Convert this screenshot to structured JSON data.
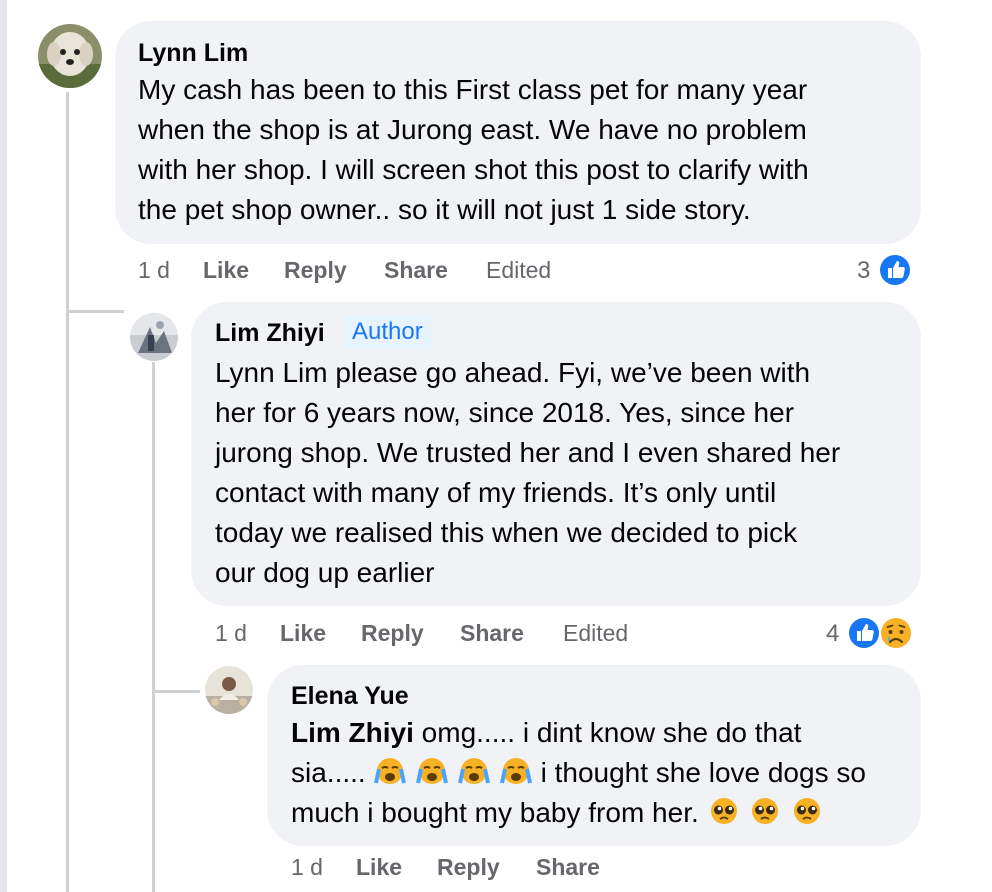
{
  "comments": [
    {
      "author": "Lynn Lim",
      "text_lines": [
        "My cash has been to this First class pet for many year",
        "when the shop is at Jurong east. We have no problem",
        "with her shop. I will screen shot this post to clarify with",
        "the pet shop owner.. so it will not just 1 side story."
      ],
      "time": "1 d",
      "like": "Like",
      "reply": "Reply",
      "share": "Share",
      "edited": "Edited",
      "reaction_count": "3",
      "reactions": [
        "like-icon"
      ]
    },
    {
      "author": "Lim Zhiyi",
      "badge": "Author",
      "text_lines": [
        "Lynn Lim please go ahead. Fyi, we’ve been with",
        "her for 6 years now, since 2018. Yes, since her",
        "jurong shop. We trusted her and I even shared her",
        "contact with many of my friends. It’s only until",
        "today we realised this when we decided to pick",
        "our dog up earlier"
      ],
      "time": "1 d",
      "like": "Like",
      "reply": "Reply",
      "share": "Share",
      "edited": "Edited",
      "reaction_count": "4",
      "reactions": [
        "like-icon",
        "sad-icon"
      ]
    },
    {
      "author": "Elena Yue",
      "mention": "Lim Zhiyi",
      "line1_rest": " omg..... i dint know she do that",
      "line2_start": "sia..... ",
      "line2_rest": " i thought she love dogs so",
      "line3_start": "much i bought my baby from her. ",
      "line2_emojis": [
        "loudly-crying-face-icon",
        "loudly-crying-face-icon",
        "loudly-crying-face-icon",
        "loudly-crying-face-icon"
      ],
      "line3_emojis": [
        "pleading-face-icon",
        "pleading-face-icon",
        "pleading-face-icon"
      ],
      "time": "1 d",
      "like": "Like",
      "reply": "Reply",
      "share": "Share"
    }
  ],
  "colors": {
    "bubble": "#f0f2f5",
    "meta_text": "#65676b",
    "like_blue": "#1877f2",
    "author_badge_bg": "#e7f3ff",
    "thread_line": "#ced0d4"
  }
}
